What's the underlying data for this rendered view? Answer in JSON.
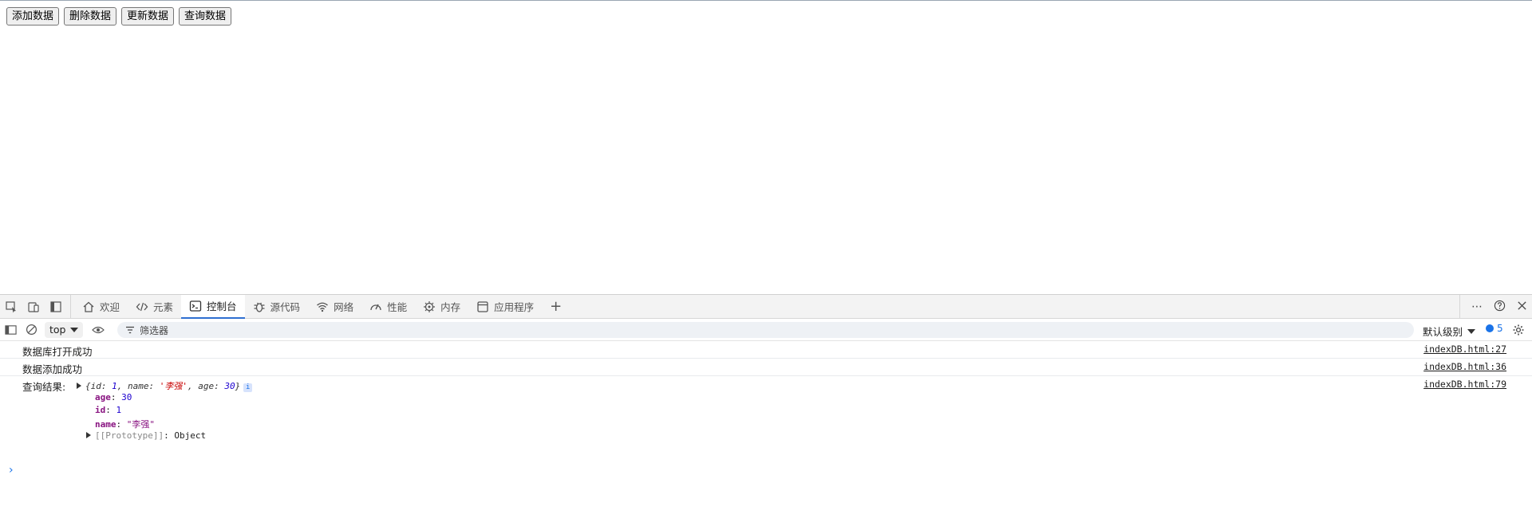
{
  "page": {
    "buttons": [
      {
        "label": "添加数据"
      },
      {
        "label": "删除数据"
      },
      {
        "label": "更新数据"
      },
      {
        "label": "查询数据"
      }
    ]
  },
  "devtools": {
    "tabs": [
      {
        "label": "欢迎",
        "icon": "home-icon"
      },
      {
        "label": "元素",
        "icon": "code-icon"
      },
      {
        "label": "控制台",
        "icon": "console-icon",
        "active": true
      },
      {
        "label": "源代码",
        "icon": "bug-icon"
      },
      {
        "label": "网络",
        "icon": "wifi-icon"
      },
      {
        "label": "性能",
        "icon": "gauge-icon"
      },
      {
        "label": "内存",
        "icon": "memory-icon"
      },
      {
        "label": "应用程序",
        "icon": "app-icon"
      }
    ],
    "toolbar": {
      "context": "top",
      "filter_placeholder": "筛选器",
      "level_label": "默认级别",
      "issues_count": "5"
    },
    "console": {
      "messages": [
        {
          "text": "数据库打开成功",
          "source": "indexDB.html:27"
        },
        {
          "text": "数据添加成功",
          "source": "indexDB.html:36"
        },
        {
          "text": "查询结果:",
          "source": "indexDB.html:79"
        }
      ],
      "object_summary": {
        "open": "{",
        "id_key": "id",
        "id_value": "1",
        "name_key": "name",
        "name_value": "'李强'",
        "age_key": "age",
        "age_value": "30",
        "close": "}"
      },
      "object_props": {
        "age_key": "age",
        "age_value": "30",
        "id_key": "id",
        "id_value": "1",
        "name_key": "name",
        "name_value": "\"李强\"",
        "proto_key": "[[Prototype]]",
        "proto_value": "Object"
      },
      "prompt": "›"
    }
  }
}
